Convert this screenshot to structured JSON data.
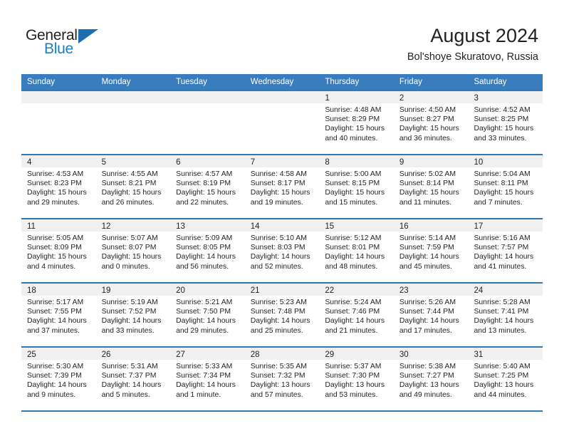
{
  "logo": {
    "word_one": "General",
    "word_two": "Blue",
    "triangle_icon": "triangle-icon",
    "accent_color": "#1b7fc4"
  },
  "header": {
    "title": "August 2024",
    "subtitle": "Bol'shoye Skuratovo, Russia"
  },
  "theme": {
    "header_blue": "#3a7dbf",
    "row_border_blue": "#2f7ab5",
    "band_gray": "#f0f0f0",
    "text_color": "#231f20"
  },
  "calendar": {
    "weekdays": [
      "Sunday",
      "Monday",
      "Tuesday",
      "Wednesday",
      "Thursday",
      "Friday",
      "Saturday"
    ],
    "weeks": [
      [
        {
          "day": "",
          "sunrise": "",
          "sunset": "",
          "daylight_line1": "",
          "daylight_line2": ""
        },
        {
          "day": "",
          "sunrise": "",
          "sunset": "",
          "daylight_line1": "",
          "daylight_line2": ""
        },
        {
          "day": "",
          "sunrise": "",
          "sunset": "",
          "daylight_line1": "",
          "daylight_line2": ""
        },
        {
          "day": "",
          "sunrise": "",
          "sunset": "",
          "daylight_line1": "",
          "daylight_line2": ""
        },
        {
          "day": "1",
          "sunrise": "Sunrise: 4:48 AM",
          "sunset": "Sunset: 8:29 PM",
          "daylight_line1": "Daylight: 15 hours",
          "daylight_line2": "and 40 minutes."
        },
        {
          "day": "2",
          "sunrise": "Sunrise: 4:50 AM",
          "sunset": "Sunset: 8:27 PM",
          "daylight_line1": "Daylight: 15 hours",
          "daylight_line2": "and 36 minutes."
        },
        {
          "day": "3",
          "sunrise": "Sunrise: 4:52 AM",
          "sunset": "Sunset: 8:25 PM",
          "daylight_line1": "Daylight: 15 hours",
          "daylight_line2": "and 33 minutes."
        }
      ],
      [
        {
          "day": "4",
          "sunrise": "Sunrise: 4:53 AM",
          "sunset": "Sunset: 8:23 PM",
          "daylight_line1": "Daylight: 15 hours",
          "daylight_line2": "and 29 minutes."
        },
        {
          "day": "5",
          "sunrise": "Sunrise: 4:55 AM",
          "sunset": "Sunset: 8:21 PM",
          "daylight_line1": "Daylight: 15 hours",
          "daylight_line2": "and 26 minutes."
        },
        {
          "day": "6",
          "sunrise": "Sunrise: 4:57 AM",
          "sunset": "Sunset: 8:19 PM",
          "daylight_line1": "Daylight: 15 hours",
          "daylight_line2": "and 22 minutes."
        },
        {
          "day": "7",
          "sunrise": "Sunrise: 4:58 AM",
          "sunset": "Sunset: 8:17 PM",
          "daylight_line1": "Daylight: 15 hours",
          "daylight_line2": "and 19 minutes."
        },
        {
          "day": "8",
          "sunrise": "Sunrise: 5:00 AM",
          "sunset": "Sunset: 8:15 PM",
          "daylight_line1": "Daylight: 15 hours",
          "daylight_line2": "and 15 minutes."
        },
        {
          "day": "9",
          "sunrise": "Sunrise: 5:02 AM",
          "sunset": "Sunset: 8:14 PM",
          "daylight_line1": "Daylight: 15 hours",
          "daylight_line2": "and 11 minutes."
        },
        {
          "day": "10",
          "sunrise": "Sunrise: 5:04 AM",
          "sunset": "Sunset: 8:11 PM",
          "daylight_line1": "Daylight: 15 hours",
          "daylight_line2": "and 7 minutes."
        }
      ],
      [
        {
          "day": "11",
          "sunrise": "Sunrise: 5:05 AM",
          "sunset": "Sunset: 8:09 PM",
          "daylight_line1": "Daylight: 15 hours",
          "daylight_line2": "and 4 minutes."
        },
        {
          "day": "12",
          "sunrise": "Sunrise: 5:07 AM",
          "sunset": "Sunset: 8:07 PM",
          "daylight_line1": "Daylight: 15 hours",
          "daylight_line2": "and 0 minutes."
        },
        {
          "day": "13",
          "sunrise": "Sunrise: 5:09 AM",
          "sunset": "Sunset: 8:05 PM",
          "daylight_line1": "Daylight: 14 hours",
          "daylight_line2": "and 56 minutes."
        },
        {
          "day": "14",
          "sunrise": "Sunrise: 5:10 AM",
          "sunset": "Sunset: 8:03 PM",
          "daylight_line1": "Daylight: 14 hours",
          "daylight_line2": "and 52 minutes."
        },
        {
          "day": "15",
          "sunrise": "Sunrise: 5:12 AM",
          "sunset": "Sunset: 8:01 PM",
          "daylight_line1": "Daylight: 14 hours",
          "daylight_line2": "and 48 minutes."
        },
        {
          "day": "16",
          "sunrise": "Sunrise: 5:14 AM",
          "sunset": "Sunset: 7:59 PM",
          "daylight_line1": "Daylight: 14 hours",
          "daylight_line2": "and 45 minutes."
        },
        {
          "day": "17",
          "sunrise": "Sunrise: 5:16 AM",
          "sunset": "Sunset: 7:57 PM",
          "daylight_line1": "Daylight: 14 hours",
          "daylight_line2": "and 41 minutes."
        }
      ],
      [
        {
          "day": "18",
          "sunrise": "Sunrise: 5:17 AM",
          "sunset": "Sunset: 7:55 PM",
          "daylight_line1": "Daylight: 14 hours",
          "daylight_line2": "and 37 minutes."
        },
        {
          "day": "19",
          "sunrise": "Sunrise: 5:19 AM",
          "sunset": "Sunset: 7:52 PM",
          "daylight_line1": "Daylight: 14 hours",
          "daylight_line2": "and 33 minutes."
        },
        {
          "day": "20",
          "sunrise": "Sunrise: 5:21 AM",
          "sunset": "Sunset: 7:50 PM",
          "daylight_line1": "Daylight: 14 hours",
          "daylight_line2": "and 29 minutes."
        },
        {
          "day": "21",
          "sunrise": "Sunrise: 5:23 AM",
          "sunset": "Sunset: 7:48 PM",
          "daylight_line1": "Daylight: 14 hours",
          "daylight_line2": "and 25 minutes."
        },
        {
          "day": "22",
          "sunrise": "Sunrise: 5:24 AM",
          "sunset": "Sunset: 7:46 PM",
          "daylight_line1": "Daylight: 14 hours",
          "daylight_line2": "and 21 minutes."
        },
        {
          "day": "23",
          "sunrise": "Sunrise: 5:26 AM",
          "sunset": "Sunset: 7:44 PM",
          "daylight_line1": "Daylight: 14 hours",
          "daylight_line2": "and 17 minutes."
        },
        {
          "day": "24",
          "sunrise": "Sunrise: 5:28 AM",
          "sunset": "Sunset: 7:41 PM",
          "daylight_line1": "Daylight: 14 hours",
          "daylight_line2": "and 13 minutes."
        }
      ],
      [
        {
          "day": "25",
          "sunrise": "Sunrise: 5:30 AM",
          "sunset": "Sunset: 7:39 PM",
          "daylight_line1": "Daylight: 14 hours",
          "daylight_line2": "and 9 minutes."
        },
        {
          "day": "26",
          "sunrise": "Sunrise: 5:31 AM",
          "sunset": "Sunset: 7:37 PM",
          "daylight_line1": "Daylight: 14 hours",
          "daylight_line2": "and 5 minutes."
        },
        {
          "day": "27",
          "sunrise": "Sunrise: 5:33 AM",
          "sunset": "Sunset: 7:34 PM",
          "daylight_line1": "Daylight: 14 hours",
          "daylight_line2": "and 1 minute."
        },
        {
          "day": "28",
          "sunrise": "Sunrise: 5:35 AM",
          "sunset": "Sunset: 7:32 PM",
          "daylight_line1": "Daylight: 13 hours",
          "daylight_line2": "and 57 minutes."
        },
        {
          "day": "29",
          "sunrise": "Sunrise: 5:37 AM",
          "sunset": "Sunset: 7:30 PM",
          "daylight_line1": "Daylight: 13 hours",
          "daylight_line2": "and 53 minutes."
        },
        {
          "day": "30",
          "sunrise": "Sunrise: 5:38 AM",
          "sunset": "Sunset: 7:27 PM",
          "daylight_line1": "Daylight: 13 hours",
          "daylight_line2": "and 49 minutes."
        },
        {
          "day": "31",
          "sunrise": "Sunrise: 5:40 AM",
          "sunset": "Sunset: 7:25 PM",
          "daylight_line1": "Daylight: 13 hours",
          "daylight_line2": "and 44 minutes."
        }
      ]
    ]
  }
}
